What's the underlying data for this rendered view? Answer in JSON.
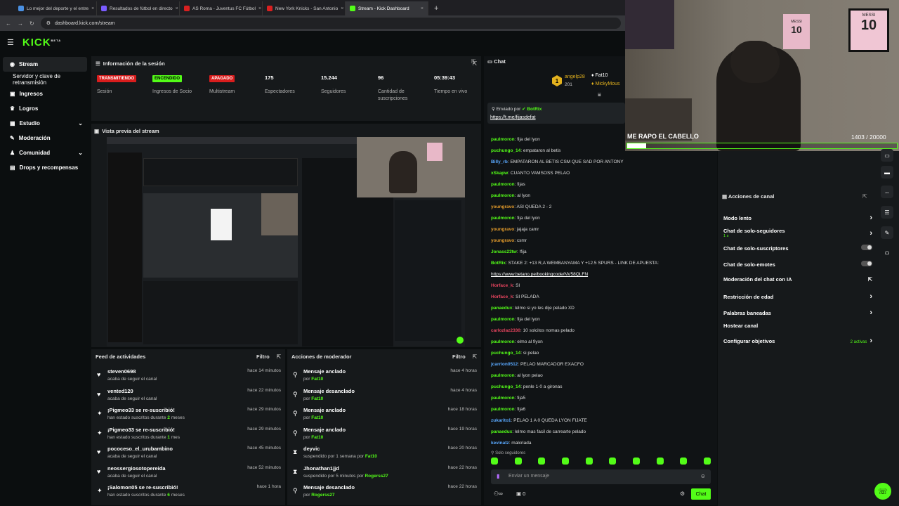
{
  "browser": {
    "tabs": [
      {
        "title": "Lo mejor del deporte y el entre",
        "color": "#4a90e2",
        "active": false
      },
      {
        "title": "Resultados de fútbol en directo",
        "color": "#7a5cff",
        "active": false
      },
      {
        "title": "AS Roma - Juventus FC Fútbol",
        "color": "#d92020",
        "active": false
      },
      {
        "title": "New York Knicks - San Antonio",
        "color": "#d92020",
        "active": false
      },
      {
        "title": "Stream - Kick Dashboard",
        "color": "#53fc18",
        "active": true
      }
    ],
    "new_tab": "+",
    "url": "dashboard.kick.com/stream"
  },
  "logo": {
    "text": "KICK",
    "sup": "BETA"
  },
  "sidebar": {
    "items": [
      {
        "label": "Stream",
        "icon": "broadcast-icon",
        "glyph": "◉"
      },
      {
        "label": "Servidor y clave de retransmisión",
        "icon": "",
        "glyph": ""
      },
      {
        "label": "Ingresos",
        "icon": "money-icon",
        "glyph": "▣"
      },
      {
        "label": "Logros",
        "icon": "trophy-icon",
        "glyph": "♛"
      },
      {
        "label": "Estudio",
        "icon": "studio-icon",
        "glyph": "▦",
        "chev": "⌄"
      },
      {
        "label": "Moderación",
        "icon": "wrench-icon",
        "glyph": "✎"
      },
      {
        "label": "Comunidad",
        "icon": "community-icon",
        "glyph": "♟",
        "chev": "⌄"
      },
      {
        "label": "Drops y recompensas",
        "icon": "gift-icon",
        "glyph": "▤"
      }
    ]
  },
  "session": {
    "title": "Información de la sesión",
    "stats": [
      {
        "value": "TRANSMITIENDO",
        "label": "Sesión",
        "kind": "red"
      },
      {
        "value": "ENCENDIDO",
        "label": "Ingresos de Socio",
        "kind": "green"
      },
      {
        "value": "APAGADO",
        "label": "Multistream",
        "kind": "red"
      },
      {
        "value": "175",
        "label": "Espectadores",
        "kind": "text"
      },
      {
        "value": "15.244",
        "label": "Seguidores",
        "kind": "text"
      },
      {
        "value": "96",
        "label": "Cantidad de suscripciones",
        "kind": "text"
      },
      {
        "value": "05:39:43",
        "label": "Tiempo en vivo",
        "kind": "text"
      }
    ]
  },
  "preview": {
    "title": "Vista previa del stream"
  },
  "feed": {
    "title": "Feed de actividades",
    "filter": "Filtro",
    "rows": [
      {
        "title": "steven0698",
        "sub": "acaba de seguir el canal",
        "time": "hace 14 minutos",
        "icon": "heart-icon",
        "glyph": "♥"
      },
      {
        "title": "vented120",
        "sub": "acaba de seguir el canal",
        "time": "hace 22 minutos",
        "icon": "heart-icon",
        "glyph": "♥"
      },
      {
        "title": "¡Pigmeo33 se re-suscribió!",
        "sub": "han estado suscritos durante",
        "hi": "2",
        "sub2": "meses",
        "time": "hace 29 minutos",
        "icon": "star-icon",
        "glyph": "✦"
      },
      {
        "title": "¡Pigmeo33 se re-suscribió!",
        "sub": "han estado suscritos durante",
        "hi": "1",
        "sub2": "mes",
        "time": "hace 29 minutos",
        "icon": "star-icon",
        "glyph": "✦"
      },
      {
        "title": "pococeso_el_urubambino",
        "sub": "acaba de seguir el canal",
        "time": "hace 45 minutos",
        "icon": "heart-icon",
        "glyph": "♥"
      },
      {
        "title": "neossergiosotopereida",
        "sub": "acaba de seguir el canal",
        "time": "hace 52 minutos",
        "icon": "heart-icon",
        "glyph": "♥"
      },
      {
        "title": "¡Salomon05 se re-suscribió!",
        "sub": "han estado suscritos durante",
        "hi": "6",
        "sub2": "meses",
        "time": "hace 1 hora",
        "icon": "star-icon",
        "glyph": "✦"
      }
    ]
  },
  "mod": {
    "title": "Acciones de moderador",
    "filter": "Filtro",
    "rows": [
      {
        "title": "Mensaje anclado",
        "sub": "por",
        "hi": "Fat10",
        "time": "hace 4 horas",
        "icon": "pin-icon",
        "glyph": "⚲"
      },
      {
        "title": "Mensaje desanclado",
        "sub": "por",
        "hi": "Fat10",
        "time": "hace 4 horas",
        "icon": "unpin-icon",
        "glyph": "⚲"
      },
      {
        "title": "Mensaje anclado",
        "sub": "por",
        "hi": "Fat10",
        "time": "hace 18 horas",
        "icon": "pin-icon",
        "glyph": "⚲"
      },
      {
        "title": "Mensaje anclado",
        "sub": "por",
        "hi": "Fat10",
        "time": "hace 19 horas",
        "icon": "pin-icon",
        "glyph": "⚲"
      },
      {
        "title": "deyvic",
        "sub": "suspendido por 1 semana por",
        "hi": "Fat10",
        "time": "hace 20 horas",
        "icon": "hourglass-icon",
        "glyph": "⧗"
      },
      {
        "title": "Jhonathan1jjd",
        "sub": "suspendido por 5 minutos por",
        "hi": "Rogerss27",
        "time": "hace 22 horas",
        "icon": "hourglass-icon",
        "glyph": "⧗"
      },
      {
        "title": "Mensaje desanclado",
        "sub": "por",
        "hi": "Rogerss27",
        "time": "hace 22 horas",
        "icon": "unpin-icon",
        "glyph": "⚲"
      }
    ]
  },
  "chat": {
    "title": "Chat",
    "top_user": "angelp28",
    "top_count": "201",
    "top_rank": "1",
    "second_user": "Fat10",
    "third_user": "MickyMous",
    "pinned_by_label": "Enviado por",
    "pinned_by": "BotRix",
    "pinned_link": "https://t.me/fijasdefat",
    "messages": [
      {
        "user": "paulmoron",
        "msg": "fija del lyon",
        "color": "#53fc18"
      },
      {
        "user": "puchungo_14",
        "msg": "empataron al betis",
        "color": "#53fc18"
      },
      {
        "user": "Billy_rb",
        "msg": "EMPATARON AL BETIS CSM QUE SAD POR ANTONY",
        "color": "#5aa9ff"
      },
      {
        "user": "xSkapw",
        "msg": "CUANTO VAMSOSS PELAO",
        "color": "#53fc18"
      },
      {
        "user": "paulmoron",
        "msg": "fijas",
        "color": "#53fc18"
      },
      {
        "user": "paulmoron",
        "msg": "al lyon",
        "color": "#53fc18"
      },
      {
        "user": "youngravo",
        "msg": "ASI QUEDA 2 - 2",
        "color": "#e39b2b"
      },
      {
        "user": "paulmoron",
        "msg": "fija del lyon",
        "color": "#53fc18"
      },
      {
        "user": "youngravo",
        "msg": "jajaja camr",
        "color": "#e39b2b"
      },
      {
        "user": "youngravo",
        "msg": "csmr",
        "color": "#e39b2b"
      },
      {
        "user": "Jonass23tw",
        "msg": "!fija",
        "color": "#53fc18"
      },
      {
        "user": "BotRix",
        "msg": "STAKE 2: +13 R,A WEMBANYAMA Y +12.5 SPURS - LINK DE APUESTA:",
        "color": "#53fc18"
      },
      {
        "user": "",
        "msg": "https://www.betano.pe/bookingcode/NV58QLFN",
        "color": "#ffffff"
      },
      {
        "user": "Horface_k",
        "msg": "SI",
        "color": "#e8455f"
      },
      {
        "user": "Horface_k",
        "msg": "SI PELADA",
        "color": "#e8455f"
      },
      {
        "user": "panaedux",
        "msg": "lelmo si yo les dije pelado XD",
        "color": "#53fc18"
      },
      {
        "user": "paulmoron",
        "msg": "fija del lyon",
        "color": "#53fc18"
      },
      {
        "user": "carlozlaz2330",
        "msg": "10 solcitos nomas pelado",
        "color": "#e8455f"
      },
      {
        "user": "paulmoron",
        "msg": "elmo al fiyon",
        "color": "#53fc18"
      },
      {
        "user": "puchungo_14",
        "msg": "si pelao",
        "color": "#53fc18"
      },
      {
        "user": "jcarrion0512",
        "msg": "PELAO MARCADOR EXACFO",
        "color": "#5aa9ff"
      },
      {
        "user": "paulmoron",
        "msg": "al lyon pelao",
        "color": "#53fc18"
      },
      {
        "user": "puchungo_14",
        "msg": "penle 1-0 a gironas",
        "color": "#53fc18"
      },
      {
        "user": "paulmoron",
        "msg": "fija5",
        "color": "#53fc18"
      },
      {
        "user": "paulmoron",
        "msg": "fija6",
        "color": "#53fc18"
      },
      {
        "user": "zukarito1",
        "msg": "PELAO 1 A 0 QUEDA LYON FIJATE",
        "color": "#5aa9ff"
      },
      {
        "user": "panaedux",
        "msg": "lelmo mas facil de carrearte pelado",
        "color": "#53fc18"
      },
      {
        "user": "kevinatz",
        "msg": "malcriada",
        "color": "#5aa9ff"
      }
    ],
    "followers_only": "Solo seguidores",
    "input_placeholder": "Enviar un mensaje",
    "counter": "0",
    "send": "Chat"
  },
  "camera": {
    "overlay_text": "ME RAPO EL CABELLO",
    "goal_current": "1403",
    "goal_total": "/ 20000",
    "progress": 0.07,
    "jersey": "MESSI",
    "jersey_num": "10"
  },
  "channel_actions": {
    "title": "Acciones de canal",
    "rows": [
      {
        "label": "Modo lento",
        "right": "chev"
      },
      {
        "label": "Chat de solo-seguidores",
        "sub": "1 s",
        "right": "chev"
      },
      {
        "label": "Chat de solo-suscriptores",
        "right": "toggle"
      },
      {
        "label": "Chat de solo-emotes",
        "right": "toggle"
      },
      {
        "label": "Moderación del chat con IA",
        "right": "ext"
      },
      {
        "label": "Restricción de edad",
        "right": "chev"
      },
      {
        "label": "Palabras baneadas",
        "right": "chev"
      },
      {
        "label": "Hostear canal",
        "right": ""
      },
      {
        "label": "Configurar objetivos",
        "active": "2 activas",
        "right": "chev"
      }
    ]
  },
  "colors": {
    "accent": "#53fc18",
    "live_red": "#d91d1d"
  }
}
